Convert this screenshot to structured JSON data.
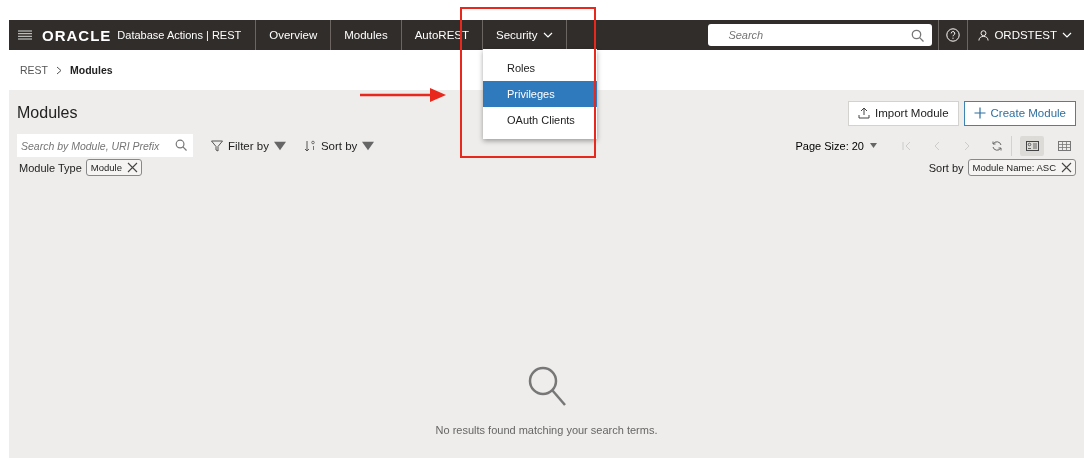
{
  "navbar": {
    "brand": "ORACLE",
    "product": "Database Actions | REST",
    "tabs": [
      {
        "label": "Overview",
        "kind": "link"
      },
      {
        "label": "Modules",
        "kind": "link"
      },
      {
        "label": "AutoREST",
        "kind": "link"
      },
      {
        "label": "Security",
        "kind": "menu",
        "expanded": true,
        "menu": [
          {
            "label": "Roles",
            "selected": false
          },
          {
            "label": "Privileges",
            "selected": true
          },
          {
            "label": "OAuth Clients",
            "selected": false
          }
        ]
      }
    ],
    "search": {
      "placeholder": "Search"
    },
    "user": "ORDSTEST"
  },
  "breadcrumb": [
    {
      "label": "REST",
      "current": false
    },
    {
      "label": "Modules",
      "current": true
    }
  ],
  "page": {
    "title": "Modules",
    "actions": [
      {
        "label": "Import Module",
        "kind": "secondary"
      },
      {
        "label": "Create Module",
        "kind": "primary"
      }
    ],
    "search": {
      "placeholder": "Search by Module, URI Prefix"
    },
    "filter_by": "Filter by",
    "sort_by": "Sort by",
    "page_size": "Page Size: 20",
    "views": [
      {
        "kind": "cards",
        "selected": true
      },
      {
        "kind": "table",
        "selected": false
      }
    ],
    "filters": [
      {
        "label": "Module Type",
        "chip": "Module"
      }
    ],
    "sort": {
      "label": "Sort by",
      "chip": "Module Name: ASC"
    },
    "empty_message": "No results found matching your search terms."
  }
}
